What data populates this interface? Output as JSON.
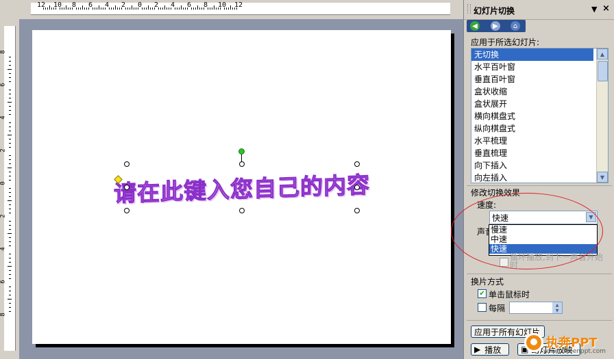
{
  "ruler": {
    "h_labels": [
      "12",
      "10",
      "8",
      "6",
      "4",
      "2",
      "0",
      "2",
      "4",
      "6",
      "8",
      "10",
      "12"
    ],
    "v_labels": [
      "8",
      "6",
      "4",
      "2",
      "0",
      "2",
      "4",
      "6",
      "8"
    ]
  },
  "slide": {
    "text": "请在此键入您自己的内容"
  },
  "pane": {
    "title": "幻灯片切换",
    "apply_label": "应用于所选幻灯片:",
    "transitions": [
      "无切换",
      "水平百叶窗",
      "垂直百叶窗",
      "盒状收缩",
      "盒状展开",
      "横向棋盘式",
      "纵向棋盘式",
      "水平梳理",
      "垂直梳理",
      "向下插入",
      "向左插入"
    ],
    "selected_transition": "无切换",
    "modify_label": "修改切换效果",
    "speed_label": "速度:",
    "speed_value": "快速",
    "speed_options": [
      "慢速",
      "中速",
      "快速"
    ],
    "sound_label": "声音",
    "loop_label": "循环播放,到下一声音开始时",
    "advance_label": "换片方式",
    "on_click_label": "单击鼠标时",
    "on_click_checked": true,
    "every_label": "每隔",
    "every_value": "",
    "apply_all_button": "应用于所有幻灯片",
    "play_button": "播放",
    "slideshow_button": "幻灯片放映"
  },
  "watermark": {
    "brand": "执奔PPT",
    "url": "www.zhibenppt.com"
  },
  "colors": {
    "canvas_bg": "#8c94a8",
    "selection": "#316ac5",
    "wordart": "#c48ae0",
    "oval": "#e02020"
  }
}
